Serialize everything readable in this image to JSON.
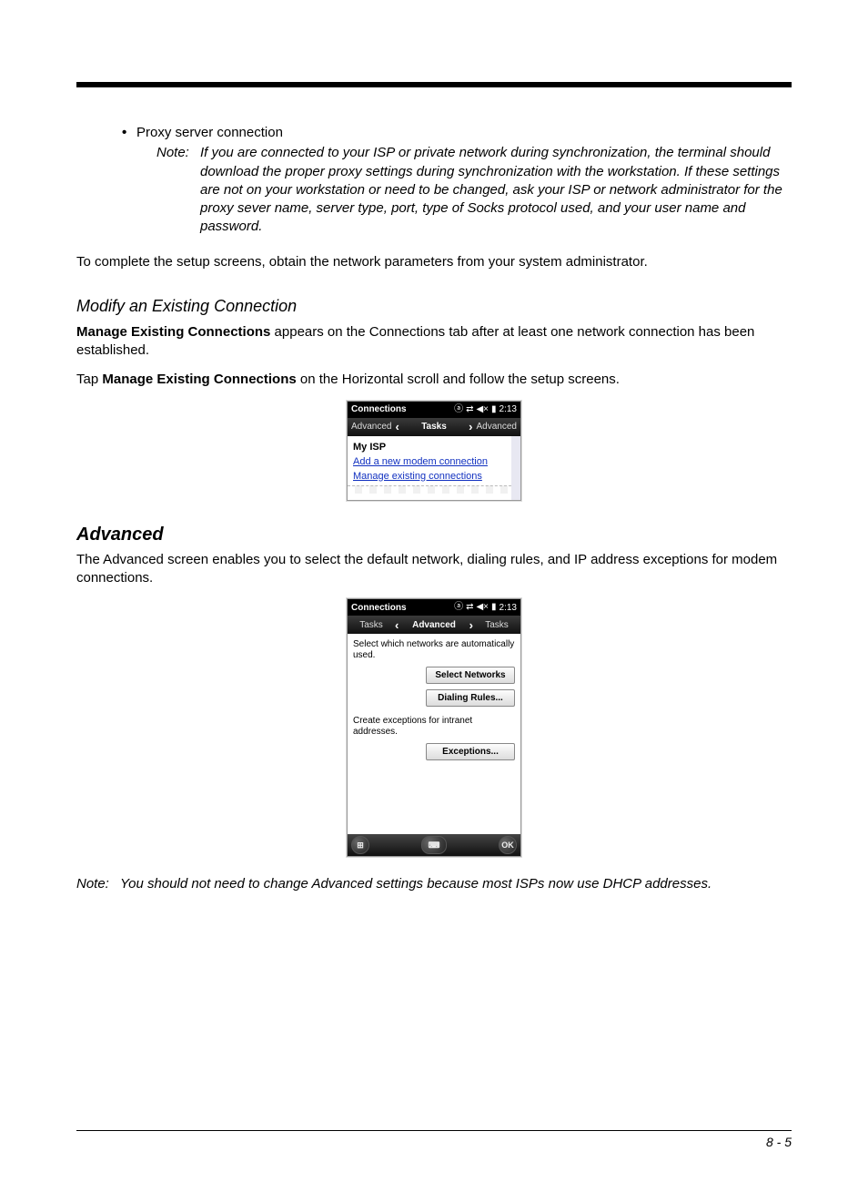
{
  "bullet": {
    "text": "Proxy server connection"
  },
  "note1": {
    "label": "Note:",
    "text": "If you are connected to your ISP or private network during synchronization, the terminal should download the proper proxy settings during synchronization with the workstation. If these settings are not on your workstation or need to be changed, ask your ISP or network administrator for the proxy sever name, server type, port, type of Socks protocol used, and your user name and password."
  },
  "para_setup": "To complete the setup screens, obtain the network parameters from your system administrator.",
  "h3_modify": "Modify an Existing Connection",
  "para_modify": {
    "bold": "Manage Existing Connections",
    "rest": " appears on the Connections tab after at least one network connection has been established."
  },
  "para_tap": {
    "pre": "Tap ",
    "bold": "Manage Existing Connections",
    "post": " on the Horizontal scroll and follow the setup screens."
  },
  "shot1": {
    "title": "Connections",
    "time": "2:13",
    "tab_left": "Advanced",
    "tab_center": "Tasks",
    "tab_right": "Advanced",
    "group": "My ISP",
    "link1": "Add a new modem connection",
    "link2": "Manage existing connections"
  },
  "h2_adv": "Advanced",
  "para_adv": "The Advanced screen enables you to select the default network, dialing rules, and IP address exceptions for modem connections.",
  "shot2": {
    "title": "Connections",
    "time": "2:13",
    "tab_left": "Tasks",
    "tab_center": "Advanced",
    "tab_right": "Tasks",
    "txt1": "Select which networks are automatically used.",
    "btn1": "Select Networks",
    "btn2": "Dialing Rules...",
    "txt2": "Create exceptions for intranet addresses.",
    "btn3": "Exceptions...",
    "ok": "OK"
  },
  "note2": {
    "label": "Note:",
    "text": "You should not need to change Advanced settings because most ISPs now use DHCP addresses."
  },
  "page_number": "8 - 5"
}
